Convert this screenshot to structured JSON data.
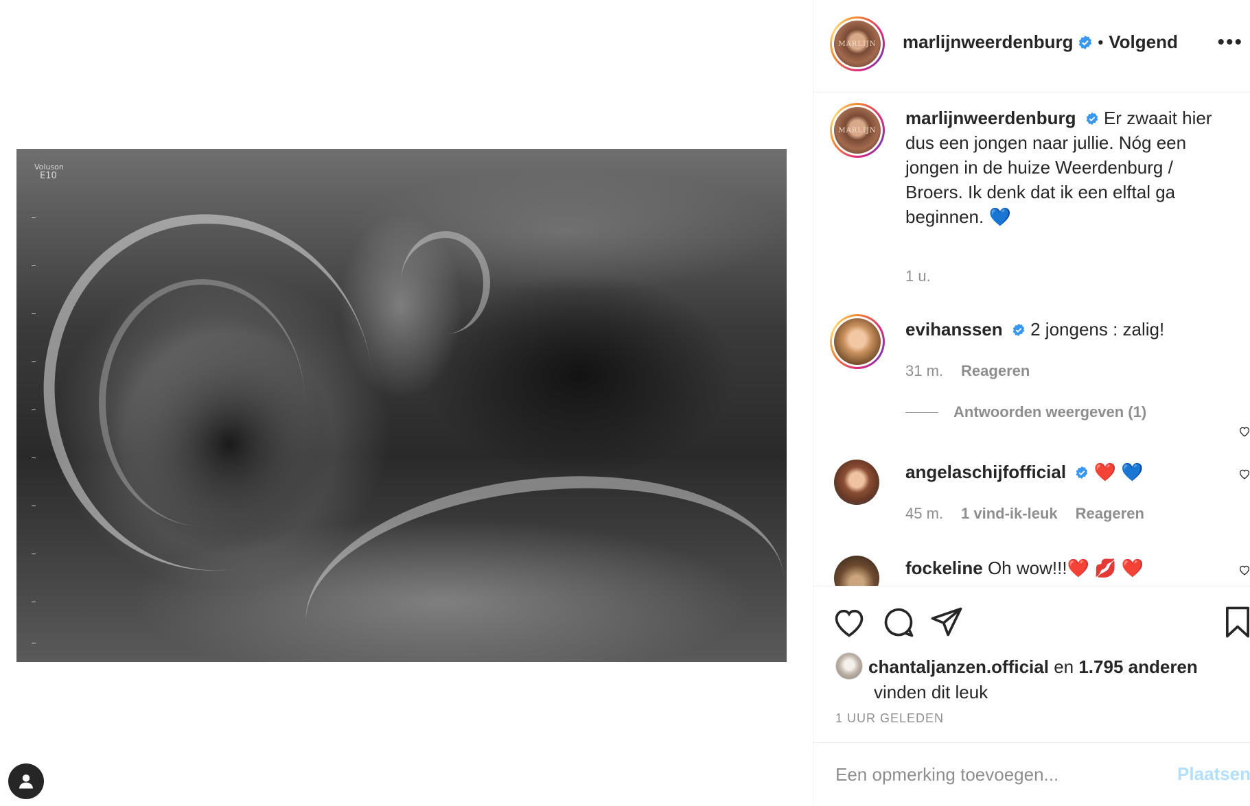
{
  "media": {
    "ultrasound_label_line1": "Voluson",
    "ultrasound_label_line2": "E10"
  },
  "post_header": {
    "username": "marlijnweerdenburg",
    "separator": "•",
    "follow_label": "Volgend",
    "more_label": "•••",
    "avatar_text": "MARLIJN"
  },
  "caption": {
    "username": "marlijnweerdenburg",
    "text": "Er zwaait hier dus een jongen naar jullie. Nóg een jongen in de huize Weerdenburg / Broers. Ik denk dat ik een elftal ga beginnen. 💙",
    "time": "1 u."
  },
  "comments": [
    {
      "username": "evihanssen",
      "verified": true,
      "text": "2 jongens : zalig!",
      "time": "31 m.",
      "likes": "",
      "reply_label": "Reageren",
      "replies_label": "Antwoorden weergeven (1)"
    },
    {
      "username": "angelaschijfofficial",
      "verified": true,
      "text": "❤️ 💙",
      "time": "45 m.",
      "likes": "1 vind-ik-leuk",
      "reply_label": "Reageren"
    },
    {
      "username": "fockeline",
      "verified": false,
      "text": "Oh wow!!!❤️ 💋 ❤️"
    }
  ],
  "likes": {
    "user": "chantaljanzen.official",
    "connector": "en",
    "others": "1.795 anderen",
    "suffix": "vinden dit leuk"
  },
  "timestamp": "1 UUR GELEDEN",
  "add_comment": {
    "placeholder": "Een opmerking toevoegen...",
    "post_label": "Plaatsen"
  },
  "colors": {
    "verified_blue": "#3897f0",
    "text": "#262626",
    "muted": "#8e8e8e",
    "post_disabled": "#b2dffc"
  }
}
